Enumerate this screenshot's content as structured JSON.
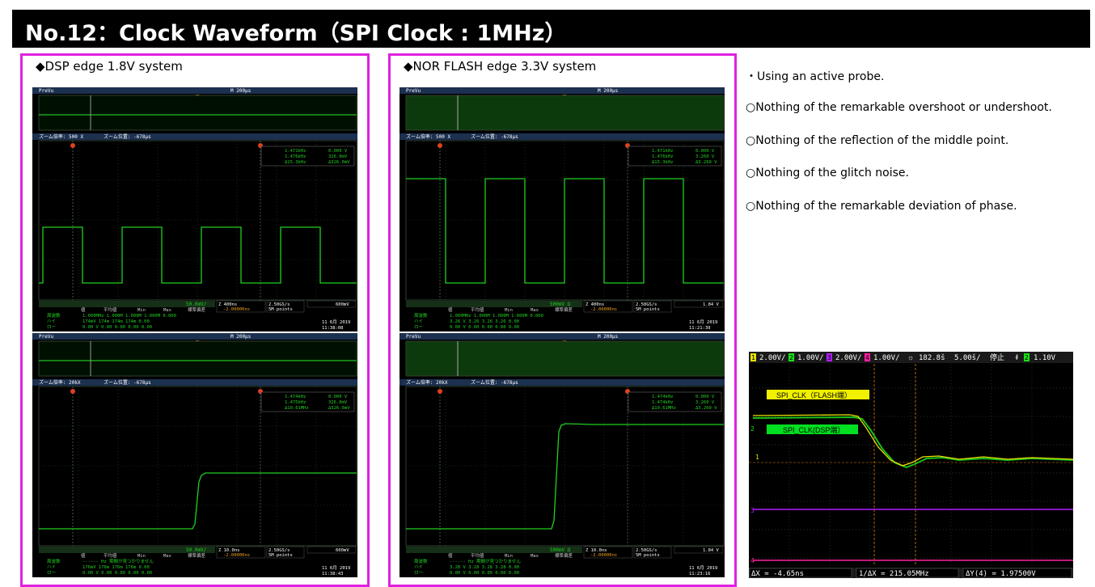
{
  "title": "No.12：Clock Waveform（SPI Clock : 1MHz）",
  "panels": [
    {
      "label": "◆DSP edge 1.8V system"
    },
    {
      "label": "◆NOR FLASH edge 3.3V system"
    }
  ],
  "notes": [
    "・Using an active probe.",
    "○Nothing of the remarkable overshoot or undershoot.",
    "○Nothing of the reflection of the middle point.",
    "○Nothing of the glitch noise.",
    "○Nothing of the remarkable deviation of phase."
  ],
  "scopes": [
    {
      "top": "PreVu",
      "tb": "M 200µs",
      "zoom": "ズーム倍率: 500 X",
      "zpos": "ズーム位置: -678µs",
      "cur1": "1.471kHz",
      "cur1v": "0.000 V",
      "cur2": "1.476kHz",
      "cur2v": "326.0mV",
      "curd": "Δ15.3kHz",
      "curdv": "Δ326.0mV",
      "ch": "50.0mV/",
      "z": "Z 400ns",
      "zoff": "-2.00000ns",
      "rate": "2.50GS/s",
      "pts": "5M points",
      "trig": "600mV",
      "r1": "1.000MHz 1.000M 1.000M 1.000M 0.000",
      "r2": "174mV 174m 174m 174m 0.00",
      "r3": "0.00 V 0.00 0.00 0.00 0.00",
      "date": "11 6月 2019",
      "time": "11:38:08"
    },
    {
      "top": "PreVu",
      "tb": "M 200µs",
      "zoom": "ズーム倍率: 500 X",
      "zpos": "ズーム位置: -678µs",
      "cur1": "1.471kHz",
      "cur1v": "0.000 V",
      "cur2": "1.476kHz",
      "cur2v": "3.260 V",
      "curd": "Δ15.3kHz",
      "curdv": "Δ3.260 V",
      "ch": "500mV Ω",
      "z": "Z 400ns",
      "zoff": "-2.00000ns",
      "rate": "2.50GS/s",
      "pts": "5M points",
      "trig": "1.84 V",
      "r1": "1.000MHz 1.000M 1.000M 1.000M 0.000",
      "r2": "3.26 V 3.26 3.26 3.26 0.00",
      "r3": "0.00 V 0.00 0.00 0.00 0.00",
      "date": "11 6月 2019",
      "time": "11:21:39"
    },
    {
      "top": "PreVu",
      "tb": "M 200µs",
      "zoom": "ズーム倍率: 20kX",
      "zpos": "ズーム位置: -678µs",
      "cur1": "1.474kHz",
      "cur1v": "0.000 V",
      "cur2": "1.475kHz",
      "cur2v": "326.0mV",
      "curd": "Δ10.61MHz",
      "curdv": "Δ326.0mV",
      "ch": "50.0mV/",
      "z": "Z 10.0ns",
      "zoff": "-2.00000ns",
      "rate": "2.50GS/s",
      "pts": "5M points",
      "trig": "600mV",
      "r1": "------ Hz 期間が見つかりません",
      "r2": "176mV 176m 176m 176m 0.00",
      "r3": "0.00 V 0.00 0.00 0.00 0.00",
      "date": "11 6月 2019",
      "time": "11:38:43"
    },
    {
      "top": "PreVu",
      "tb": "M 200µs",
      "zoom": "ズーム倍率: 20kX",
      "zpos": "ズーム位置: -678µs",
      "cur1": "1.474kHz",
      "cur1v": "0.000 V",
      "cur2": "1.474kHz",
      "cur2v": "3.260 V",
      "curd": "Δ10.61MHz",
      "curdv": "Δ3.260 V",
      "ch": "500mV Ω",
      "z": "Z 10.0ns",
      "zoff": "-2.00000ns",
      "rate": "2.50GS/s",
      "pts": "5M points",
      "trig": "1.84 V",
      "r1": "------ Hz 期間が見つかりません",
      "r2": "3.28 V 3.28 3.28 3.28 0.00",
      "r3": "0.00 V 0.00 0.00 0.00 0.00",
      "date": "11 6月 2019",
      "time": "11:23:16"
    }
  ],
  "meas_headers": {
    "h1": "値",
    "h2": "平均値",
    "h3": "Min",
    "h4": "Max",
    "h5": "標準偏差"
  },
  "meas_rows": {
    "a": "周波数",
    "b": "ハイ",
    "c": "ロー"
  },
  "right_scope": {
    "ch1": "2.00V/",
    "ch2": "1.00V/",
    "ch3": "2.00V/",
    "ch4": "1.00V/",
    "pos": "182.8š",
    "tdiv": "5.00š/",
    "mode": "停止",
    "trig": "1.10V",
    "label_flash": "SPI_CLK（FLASH端）",
    "label_dsp": "SPI_CLK(DSP端）",
    "dx": "ΔX = -4.65ns",
    "inv": "1/ΔX = 215.05MHz",
    "dy": "ΔY(4) = 1.97500V",
    "colors": {
      "ch1": "#e8e000",
      "ch2": "#18e018",
      "ch3": "#b020ff",
      "ch4": "#ff20a0"
    }
  }
}
